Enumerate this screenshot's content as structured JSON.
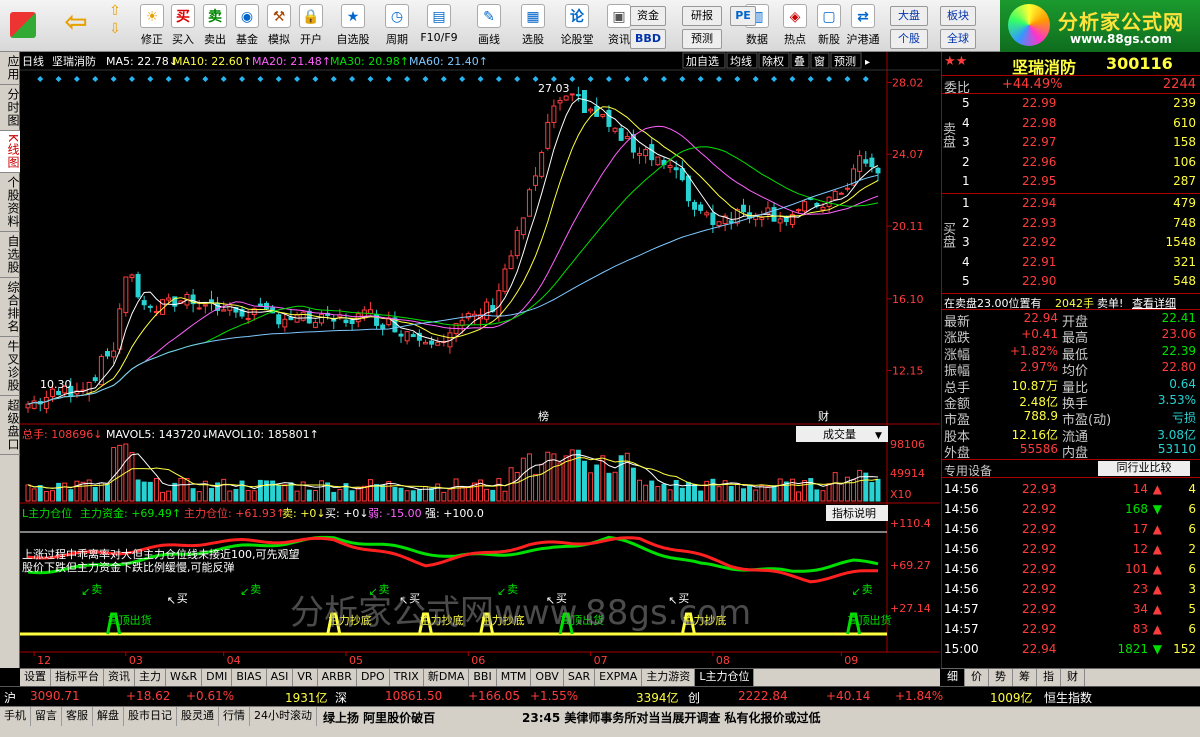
{
  "toolbar": {
    "items": [
      {
        "label": "修正",
        "icon": "arrow-up-down-icon"
      },
      {
        "label": "买入",
        "icon": "buy-icon"
      },
      {
        "label": "卖出",
        "icon": "sell-icon"
      },
      {
        "label": "基金",
        "icon": "fund-icon"
      },
      {
        "label": "模拟",
        "icon": "hammer-icon"
      },
      {
        "label": "开户",
        "icon": "lock-icon"
      },
      {
        "label": "自选股",
        "icon": "star-icon"
      },
      {
        "label": "周期",
        "icon": "clock-icon"
      },
      {
        "label": "F10/F9",
        "icon": "f10-icon"
      },
      {
        "label": "画线",
        "icon": "pen-icon"
      },
      {
        "label": "选股",
        "icon": "filter-icon"
      },
      {
        "label": "论股堂",
        "icon": "forum-icon"
      },
      {
        "label": "资讯",
        "icon": "news-icon"
      },
      {
        "label": "数据",
        "icon": "data-icon"
      },
      {
        "label": "热点",
        "icon": "hot-icon"
      },
      {
        "label": "新股",
        "icon": "newstock-icon"
      },
      {
        "label": "沪港通",
        "icon": "sse-hk-icon"
      }
    ],
    "small": {
      "zijin": "资金",
      "bbd": "BBD",
      "yanbao": "研报",
      "yuce": "预测",
      "dapan": "大盘",
      "geban": "个股",
      "bankuai": "板块",
      "quanqiu": "全球",
      "pe": "PE"
    }
  },
  "logo": {
    "title": "分析家公式网",
    "url": "www.88gs.com"
  },
  "leftbar": [
    "应用",
    "分时图",
    "K线图",
    "个股资料",
    "自选股",
    "综合排名",
    "牛叉诊股",
    "超级盘口"
  ],
  "chart": {
    "header": {
      "period": "日线",
      "name": "坚瑞消防",
      "ma5": "MA5: 22.78↓",
      "ma10": "MA10: 22.60↑",
      "ma20": "MA20: 21.48↑",
      "ma30": "MA30: 20.98↑",
      "ma60": "MA60: 21.40↑"
    },
    "buttons": [
      "加自选",
      "均线",
      "除权",
      "叠",
      "窗",
      "预测"
    ],
    "price_axis": [
      "28.02",
      "24.07",
      "20.11",
      "16.10",
      "12.15"
    ],
    "high_label": "27.03",
    "low_label": "10.30",
    "markers": {
      "bang": "榜",
      "cai": "财"
    },
    "vol": {
      "label": "总手: 108696↓",
      "mavol5": "MAVOL5: 143720↓",
      "mavol10": "MAVOL10: 185801↑",
      "btn": "成交量",
      "axis": [
        "98106",
        "49914",
        "X10"
      ]
    },
    "ind": {
      "label": "L主力仓位",
      "zljj": "主力资金: +69.49↑",
      "zlcw": "主力仓位: +61.93↑",
      "mai": "卖: +0↓",
      "buy": "买: +0↓",
      "ruo": "弱: -15.00",
      "qiang": "强: +100.0",
      "btn": "指标说明",
      "axis": [
        "+110.4",
        "+69.27",
        "+27.14"
      ],
      "note1": "上涨过程中乖离率对大但主力仓位线未接近100,可先观望",
      "note2": "股价下跌但主力资金下跌比例缓慢,可能反弹",
      "tags": {
        "sell": "卖",
        "buy": "买",
        "gaoding": "高顶出货",
        "zhuli": "主力抄底"
      }
    },
    "months": [
      "12",
      "03",
      "04",
      "05",
      "06",
      "07",
      "08",
      "09"
    ],
    "watermark": "分析家公式网www.88gs.com"
  },
  "quote": {
    "name": "坚瑞消防",
    "code": "300116",
    "weibi_label": "委比",
    "weibi": "+44.49%",
    "weicha": "2244",
    "sell_label": "卖盘",
    "buy_label": "买盘",
    "asks": [
      [
        "5",
        "22.99",
        "239"
      ],
      [
        "4",
        "22.98",
        "610"
      ],
      [
        "3",
        "22.97",
        "158"
      ],
      [
        "2",
        "22.96",
        "106"
      ],
      [
        "1",
        "22.95",
        "287"
      ]
    ],
    "bids": [
      [
        "1",
        "22.94",
        "479"
      ],
      [
        "2",
        "22.93",
        "748"
      ],
      [
        "3",
        "22.92",
        "1548"
      ],
      [
        "4",
        "22.91",
        "321"
      ],
      [
        "5",
        "22.90",
        "548"
      ]
    ],
    "notice_a": "在卖盘23.00位置有",
    "notice_b": "2042手",
    "notice_c": "卖单!",
    "notice_d": "查看详细",
    "stats": [
      [
        "最新",
        "22.94",
        "开盘",
        "22.41"
      ],
      [
        "涨跌",
        "+0.41",
        "最高",
        "23.06"
      ],
      [
        "涨幅",
        "+1.82%",
        "最低",
        "22.39"
      ],
      [
        "振幅",
        "2.97%",
        "均价",
        "22.80"
      ],
      [
        "总手",
        "10.87万",
        "量比",
        "0.64"
      ],
      [
        "金额",
        "2.48亿",
        "换手",
        "3.53%"
      ],
      [
        "市盈",
        "788.9",
        "市盈(动)",
        "亏损"
      ],
      [
        "股本",
        "12.16亿",
        "流通",
        "3.08亿"
      ],
      [
        "外盘",
        "55586",
        "内盘",
        "53110"
      ]
    ],
    "device": "专用设备",
    "industry": "同行业比较",
    "ticks": [
      [
        "14:56",
        "22.93",
        "14",
        "up",
        "4"
      ],
      [
        "14:56",
        "22.92",
        "168",
        "down",
        "6"
      ],
      [
        "14:56",
        "22.92",
        "17",
        "up",
        "6"
      ],
      [
        "14:56",
        "22.92",
        "12",
        "up",
        "2"
      ],
      [
        "14:56",
        "22.92",
        "101",
        "up",
        "6"
      ],
      [
        "14:56",
        "22.92",
        "23",
        "up",
        "3"
      ],
      [
        "14:57",
        "22.92",
        "34",
        "up",
        "5"
      ],
      [
        "14:57",
        "22.92",
        "83",
        "up",
        "6"
      ],
      [
        "15:00",
        "22.94",
        "1821",
        "down",
        "152"
      ]
    ]
  },
  "tabs": [
    "设置",
    "指标平台",
    "资讯",
    "主力",
    "W&R",
    "DMI",
    "BIAS",
    "ASI",
    "VR",
    "ARBR",
    "DPO",
    "TRIX",
    "新DMA",
    "BBI",
    "MTM",
    "OBV",
    "SAR",
    "EXPMA",
    "主力游资",
    "L主力仓位"
  ],
  "rtabs": [
    "细",
    "价",
    "势",
    "筹",
    "指",
    "财"
  ],
  "index": {
    "sh": "沪",
    "sh_v": "3090.71",
    "sh_c": "+18.62",
    "sh_p": "+0.61%",
    "sh_a": "1931亿",
    "sz": "深",
    "sz_v": "10861.50",
    "sz_c": "+166.05",
    "sz_p": "+1.55%",
    "sz_a": "3394亿",
    "cy": "创",
    "cy_v": "2222.84",
    "cy_c": "+40.14",
    "cy_p": "+1.84%",
    "cy_a": "1009亿",
    "hs": "恒生指数"
  },
  "bottom": {
    "items": [
      "手机",
      "留言",
      "客服",
      "解盘",
      "股市日记",
      "股灵通",
      "行情",
      "24小时滚动"
    ],
    "news1": "绿上扬 阿里股价破百",
    "news2": "23:45 美律师事务所对当当展开调查 私有化报价或过低"
  }
}
